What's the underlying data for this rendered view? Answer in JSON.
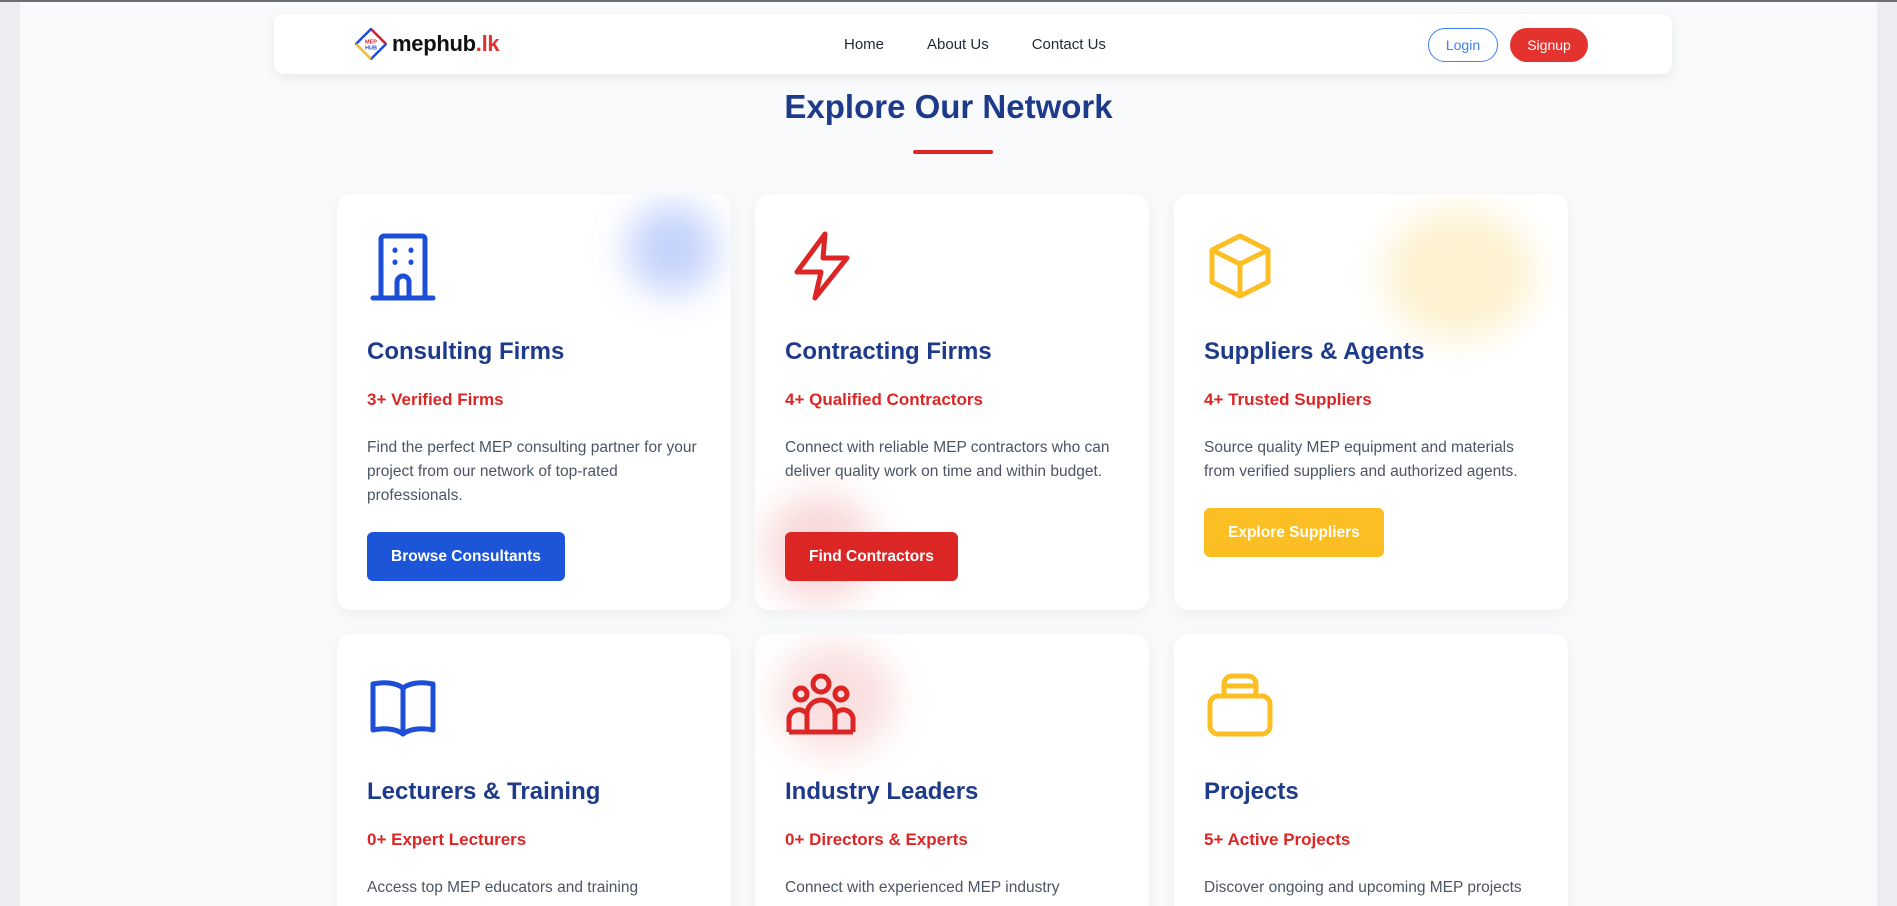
{
  "brand": {
    "name": "mephub",
    "tld": ".lk",
    "mark_text": "MEP HUB",
    "colors": {
      "blue": "#1d4ed8",
      "red": "#dc2626",
      "yellow": "#fbbf24"
    }
  },
  "nav": {
    "links": [
      "Home",
      "About Us",
      "Contact Us"
    ],
    "login_label": "Login",
    "signup_label": "Signup"
  },
  "section": {
    "title": "Explore Our Network"
  },
  "cards": [
    {
      "icon": "building-icon",
      "title": "Consulting Firms",
      "stat": "3+ Verified Firms",
      "description": "Find the perfect MEP consulting partner for your project from our network of top-rated professionals.",
      "button_label": "Browse Consultants",
      "accent": "#1d4ed8"
    },
    {
      "icon": "lightning-bolt-icon",
      "title": "Contracting Firms",
      "stat": "4+ Qualified Contractors",
      "description": "Connect with reliable MEP contractors who can deliver quality work on time and within budget.",
      "button_label": "Find Contractors",
      "accent": "#dc2626"
    },
    {
      "icon": "cube-icon",
      "title": "Suppliers & Agents",
      "stat": "4+ Trusted Suppliers",
      "description": "Source quality MEP equipment and materials from verified suppliers and authorized agents.",
      "button_label": "Explore Suppliers",
      "accent": "#fbbf24"
    },
    {
      "icon": "open-book-icon",
      "title": "Lecturers & Training",
      "stat": "0+ Expert Lecturers",
      "description": "Access top MEP educators and training",
      "accent": "#1d4ed8"
    },
    {
      "icon": "users-group-icon",
      "title": "Industry Leaders",
      "stat": "0+ Directors & Experts",
      "description": "Connect with experienced MEP industry",
      "accent": "#dc2626"
    },
    {
      "icon": "briefcase-icon",
      "title": "Projects",
      "stat": "5+ Active Projects",
      "description": "Discover ongoing and upcoming MEP projects",
      "accent": "#fbbf24"
    }
  ]
}
